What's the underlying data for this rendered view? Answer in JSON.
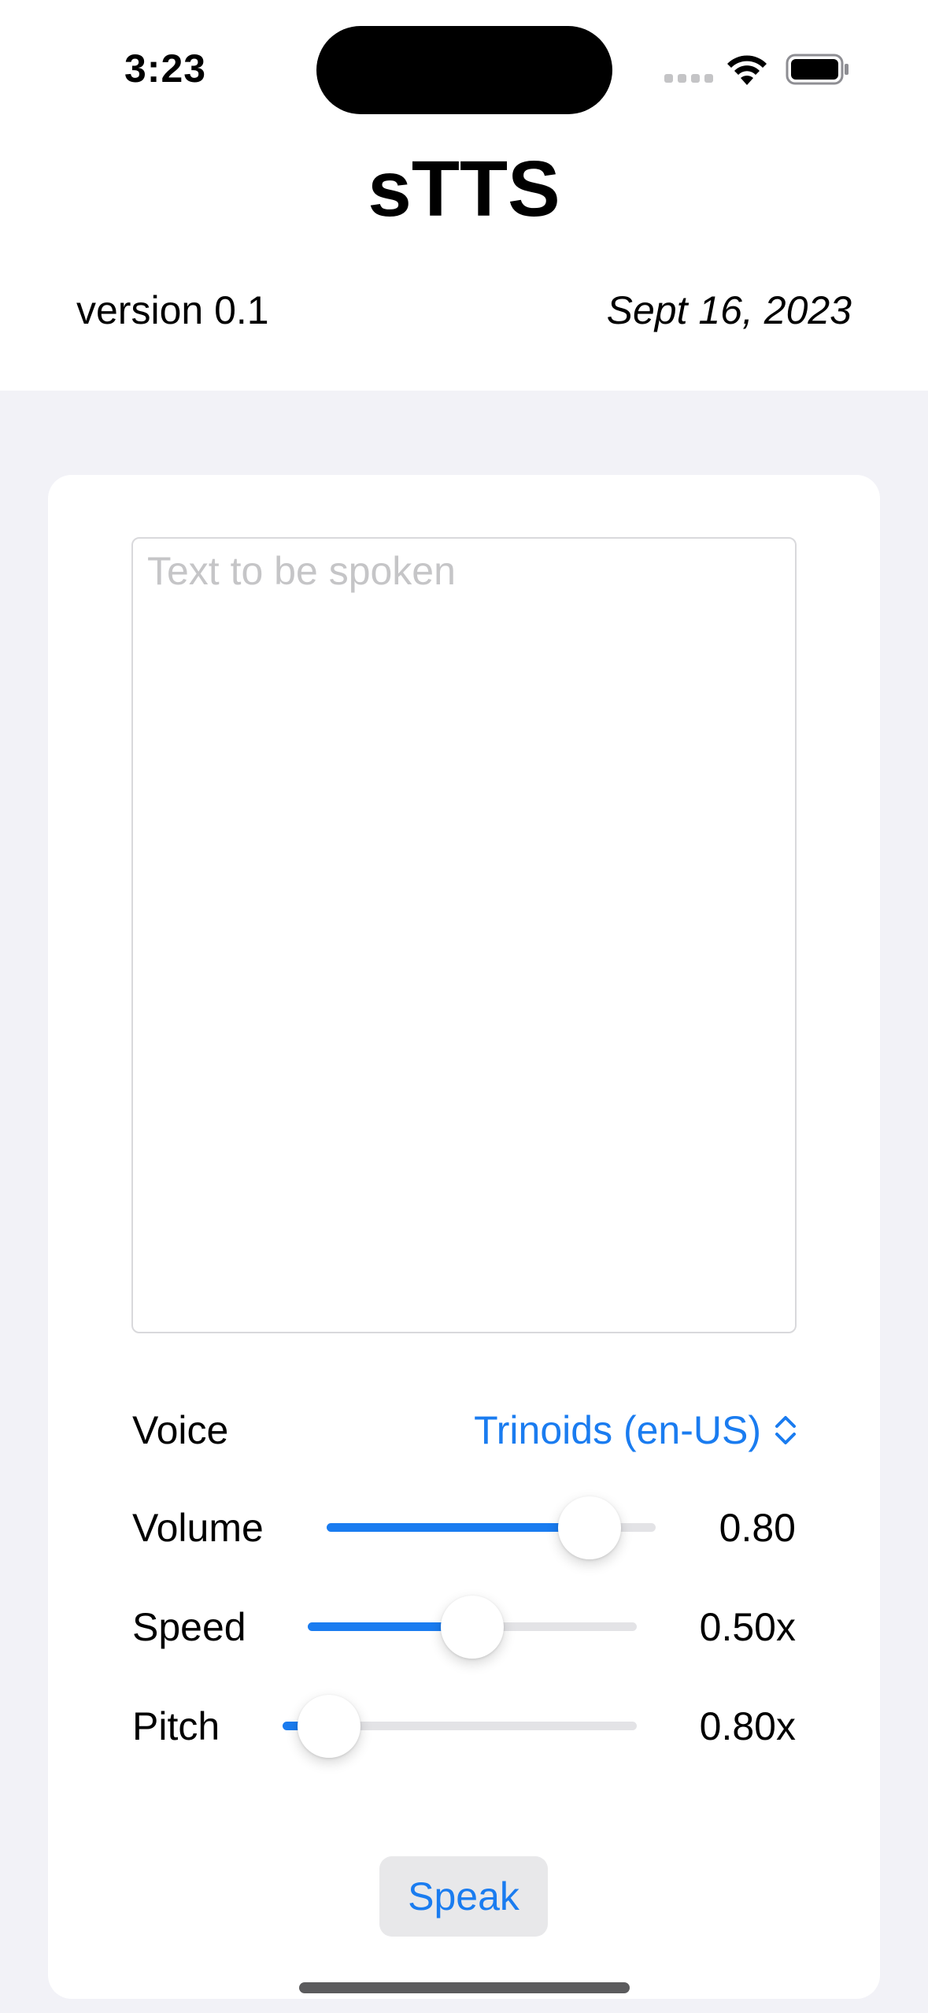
{
  "status_bar": {
    "time": "3:23"
  },
  "header": {
    "title": "sTTS",
    "version": "version 0.1",
    "date": "Sept 16, 2023"
  },
  "input": {
    "placeholder": "Text to be spoken",
    "value": ""
  },
  "controls": {
    "voice": {
      "label": "Voice",
      "selected": "Trinoids (en-US)"
    },
    "volume": {
      "label": "Volume",
      "value": 0.8,
      "display": "0.80"
    },
    "speed": {
      "label": "Speed",
      "value": 0.5,
      "display": "0.50x"
    },
    "pitch": {
      "label": "Pitch",
      "value": 0.8,
      "display": "0.80x",
      "fraction": 0.13
    }
  },
  "speak_button": {
    "label": "Speak"
  },
  "colors": {
    "accent": "#1a7cf0",
    "background": "#f2f2f7"
  }
}
